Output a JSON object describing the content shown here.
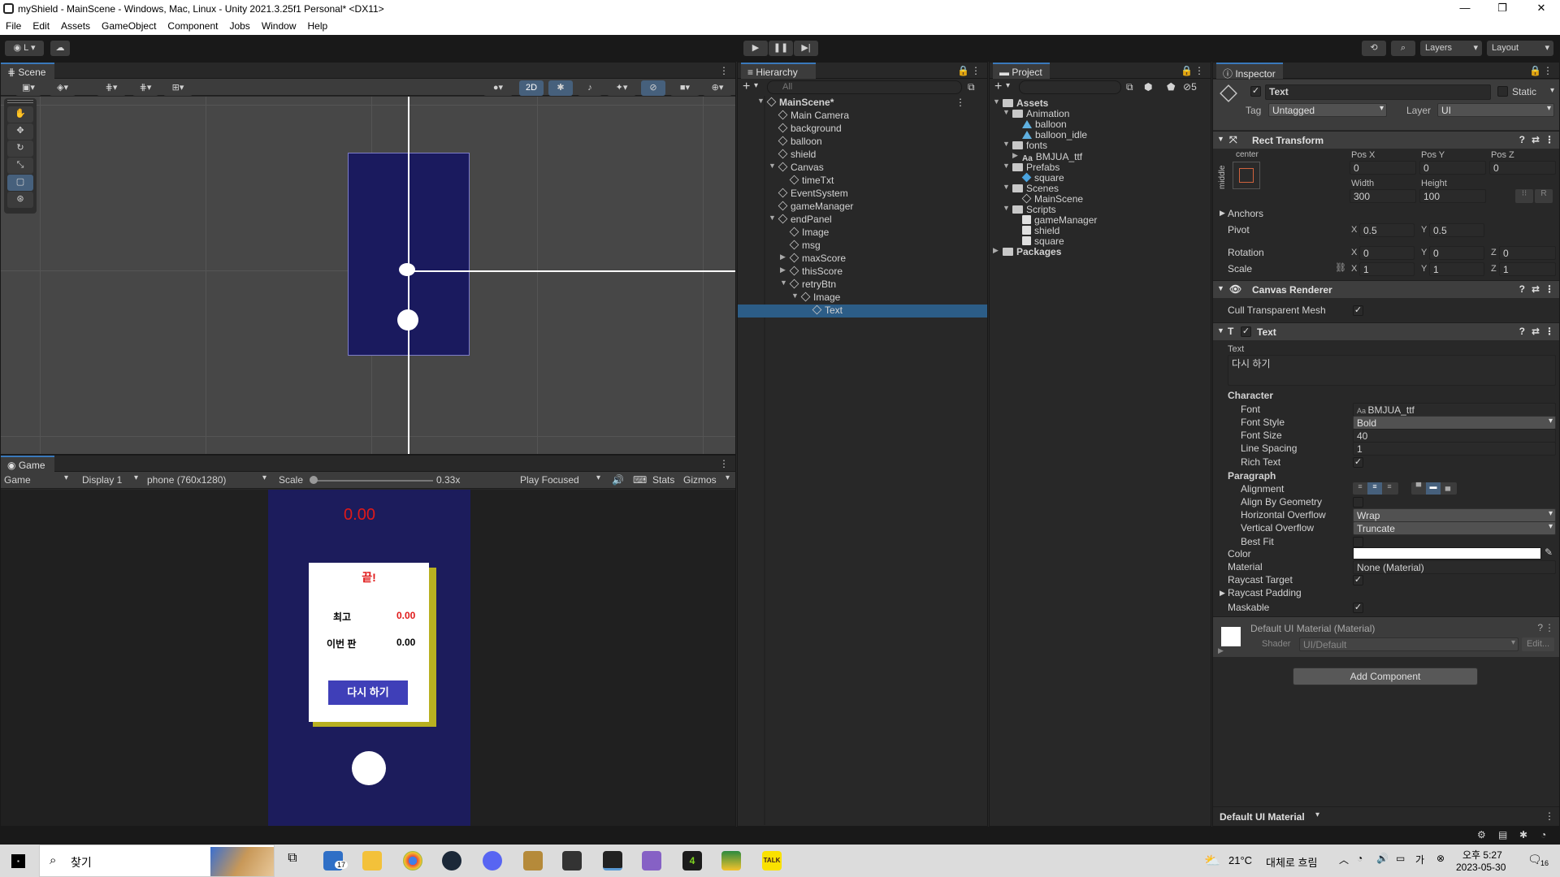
{
  "window": {
    "title": "myShield - MainScene - Windows, Mac, Linux - Unity 2021.3.25f1 Personal* <DX11>"
  },
  "menu": [
    "File",
    "Edit",
    "Assets",
    "GameObject",
    "Component",
    "Jobs",
    "Window",
    "Help"
  ],
  "toolbar": {
    "account": "L",
    "layers": "Layers",
    "layout": "Layout"
  },
  "scene": {
    "tab": "Scene",
    "mode_2d": "2D"
  },
  "game": {
    "tab": "Game",
    "view": "Game",
    "display": "Display 1",
    "resolution": "phone (760x1280)",
    "scale_label": "Scale",
    "scale_value": "0.33x",
    "play_mode": "Play Focused",
    "stats": "Stats",
    "gizmos": "Gizmos",
    "timer": "0.00",
    "panel_title": "끝!",
    "best_label": "최고",
    "best_value": "0.00",
    "current_label": "이번 판",
    "current_value": "0.00",
    "retry": "다시 하기"
  },
  "hierarchy": {
    "tab": "Hierarchy",
    "search_placeholder": "All",
    "items": [
      {
        "label": "MainScene*",
        "depth": 0,
        "expanded": true,
        "bold": true
      },
      {
        "label": "Main Camera",
        "depth": 1
      },
      {
        "label": "background",
        "depth": 1
      },
      {
        "label": "balloon",
        "depth": 1
      },
      {
        "label": "shield",
        "depth": 1
      },
      {
        "label": "Canvas",
        "depth": 1,
        "expanded": true
      },
      {
        "label": "timeTxt",
        "depth": 2
      },
      {
        "label": "EventSystem",
        "depth": 1
      },
      {
        "label": "gameManager",
        "depth": 1
      },
      {
        "label": "endPanel",
        "depth": 1,
        "expanded": true
      },
      {
        "label": "Image",
        "depth": 2
      },
      {
        "label": "msg",
        "depth": 2
      },
      {
        "label": "maxScore",
        "depth": 2,
        "collapsed": true
      },
      {
        "label": "thisScore",
        "depth": 2,
        "collapsed": true
      },
      {
        "label": "retryBtn",
        "depth": 2,
        "expanded": true
      },
      {
        "label": "Image",
        "depth": 3,
        "expanded": true
      },
      {
        "label": "Text",
        "depth": 4,
        "selected": true
      }
    ]
  },
  "project": {
    "tab": "Project",
    "hidden_count": "5",
    "items": [
      {
        "label": "Assets",
        "depth": 0,
        "type": "folder",
        "expanded": true,
        "bold": true
      },
      {
        "label": "Animation",
        "depth": 1,
        "type": "folder",
        "expanded": true
      },
      {
        "label": "balloon",
        "depth": 2,
        "type": "anim"
      },
      {
        "label": "balloon_idle",
        "depth": 2,
        "type": "anim"
      },
      {
        "label": "fonts",
        "depth": 1,
        "type": "folder",
        "expanded": true
      },
      {
        "label": "BMJUA_ttf",
        "depth": 2,
        "type": "font",
        "collapsed": true
      },
      {
        "label": "Prefabs",
        "depth": 1,
        "type": "folder",
        "expanded": true
      },
      {
        "label": "square",
        "depth": 2,
        "type": "prefab"
      },
      {
        "label": "Scenes",
        "depth": 1,
        "type": "folder",
        "expanded": true
      },
      {
        "label": "MainScene",
        "depth": 2,
        "type": "scene"
      },
      {
        "label": "Scripts",
        "depth": 1,
        "type": "folder",
        "expanded": true
      },
      {
        "label": "gameManager",
        "depth": 2,
        "type": "script"
      },
      {
        "label": "shield",
        "depth": 2,
        "type": "script"
      },
      {
        "label": "square",
        "depth": 2,
        "type": "script"
      },
      {
        "label": "Packages",
        "depth": 0,
        "type": "folder",
        "collapsed": true,
        "bold": true
      }
    ]
  },
  "inspector": {
    "tab": "Inspector",
    "object_name": "Text",
    "static_label": "Static",
    "tag_label": "Tag",
    "tag_value": "Untagged",
    "layer_label": "Layer",
    "layer_value": "UI",
    "rect": {
      "title": "Rect Transform",
      "anchor_h": "center",
      "anchor_v": "middle",
      "posx_label": "Pos X",
      "posy_label": "Pos Y",
      "posz_label": "Pos Z",
      "posx": "0",
      "posy": "0",
      "posz": "0",
      "width_label": "Width",
      "height_label": "Height",
      "width": "300",
      "height": "100",
      "anchors": "Anchors",
      "pivot": "Pivot",
      "pivot_x": "0.5",
      "pivot_y": "0.5",
      "rotation": "Rotation",
      "rot_x": "0",
      "rot_y": "0",
      "rot_z": "0",
      "scale": "Scale",
      "scale_x": "1",
      "scale_y": "1",
      "scale_z": "1",
      "r_button": "R"
    },
    "canvas_renderer": {
      "title": "Canvas Renderer",
      "cull": "Cull Transparent Mesh"
    },
    "text": {
      "title": "Text",
      "text_label": "Text",
      "text_value": "다시 하기",
      "character": "Character",
      "font_label": "Font",
      "font_value": "BMJUA_ttf",
      "style_label": "Font Style",
      "style_value": "Bold",
      "size_label": "Font Size",
      "size_value": "40",
      "spacing_label": "Line Spacing",
      "spacing_value": "1",
      "rich_label": "Rich Text",
      "paragraph": "Paragraph",
      "alignment": "Alignment",
      "align_geom": "Align By Geometry",
      "h_overflow": "Horizontal Overflow",
      "h_overflow_value": "Wrap",
      "v_overflow": "Vertical Overflow",
      "v_overflow_value": "Truncate",
      "best_fit": "Best Fit",
      "color": "Color",
      "material": "Material",
      "material_value": "None (Material)",
      "raycast_target": "Raycast Target",
      "raycast_padding": "Raycast Padding",
      "maskable": "Maskable"
    },
    "material": {
      "name": "Default UI Material (Material)",
      "shader_label": "Shader",
      "shader_value": "UI/Default",
      "edit": "Edit..."
    },
    "add_component": "Add Component",
    "footer": "Default UI Material"
  },
  "taskbar": {
    "search": "찾기",
    "weather_temp": "21°C",
    "weather_text": "대체로 흐림",
    "time": "오후 5:27",
    "date": "2023-05-30",
    "mail_badge": "17",
    "notif_badge": "16"
  },
  "colors": {
    "accent": "#3a79bb",
    "scene_blue": "#1a1a5e",
    "game_blue": "#1c1c5c",
    "timer_red": "#e01919",
    "retry_btn": "#3f3fb8",
    "panel_shadow": "#b8b020"
  }
}
